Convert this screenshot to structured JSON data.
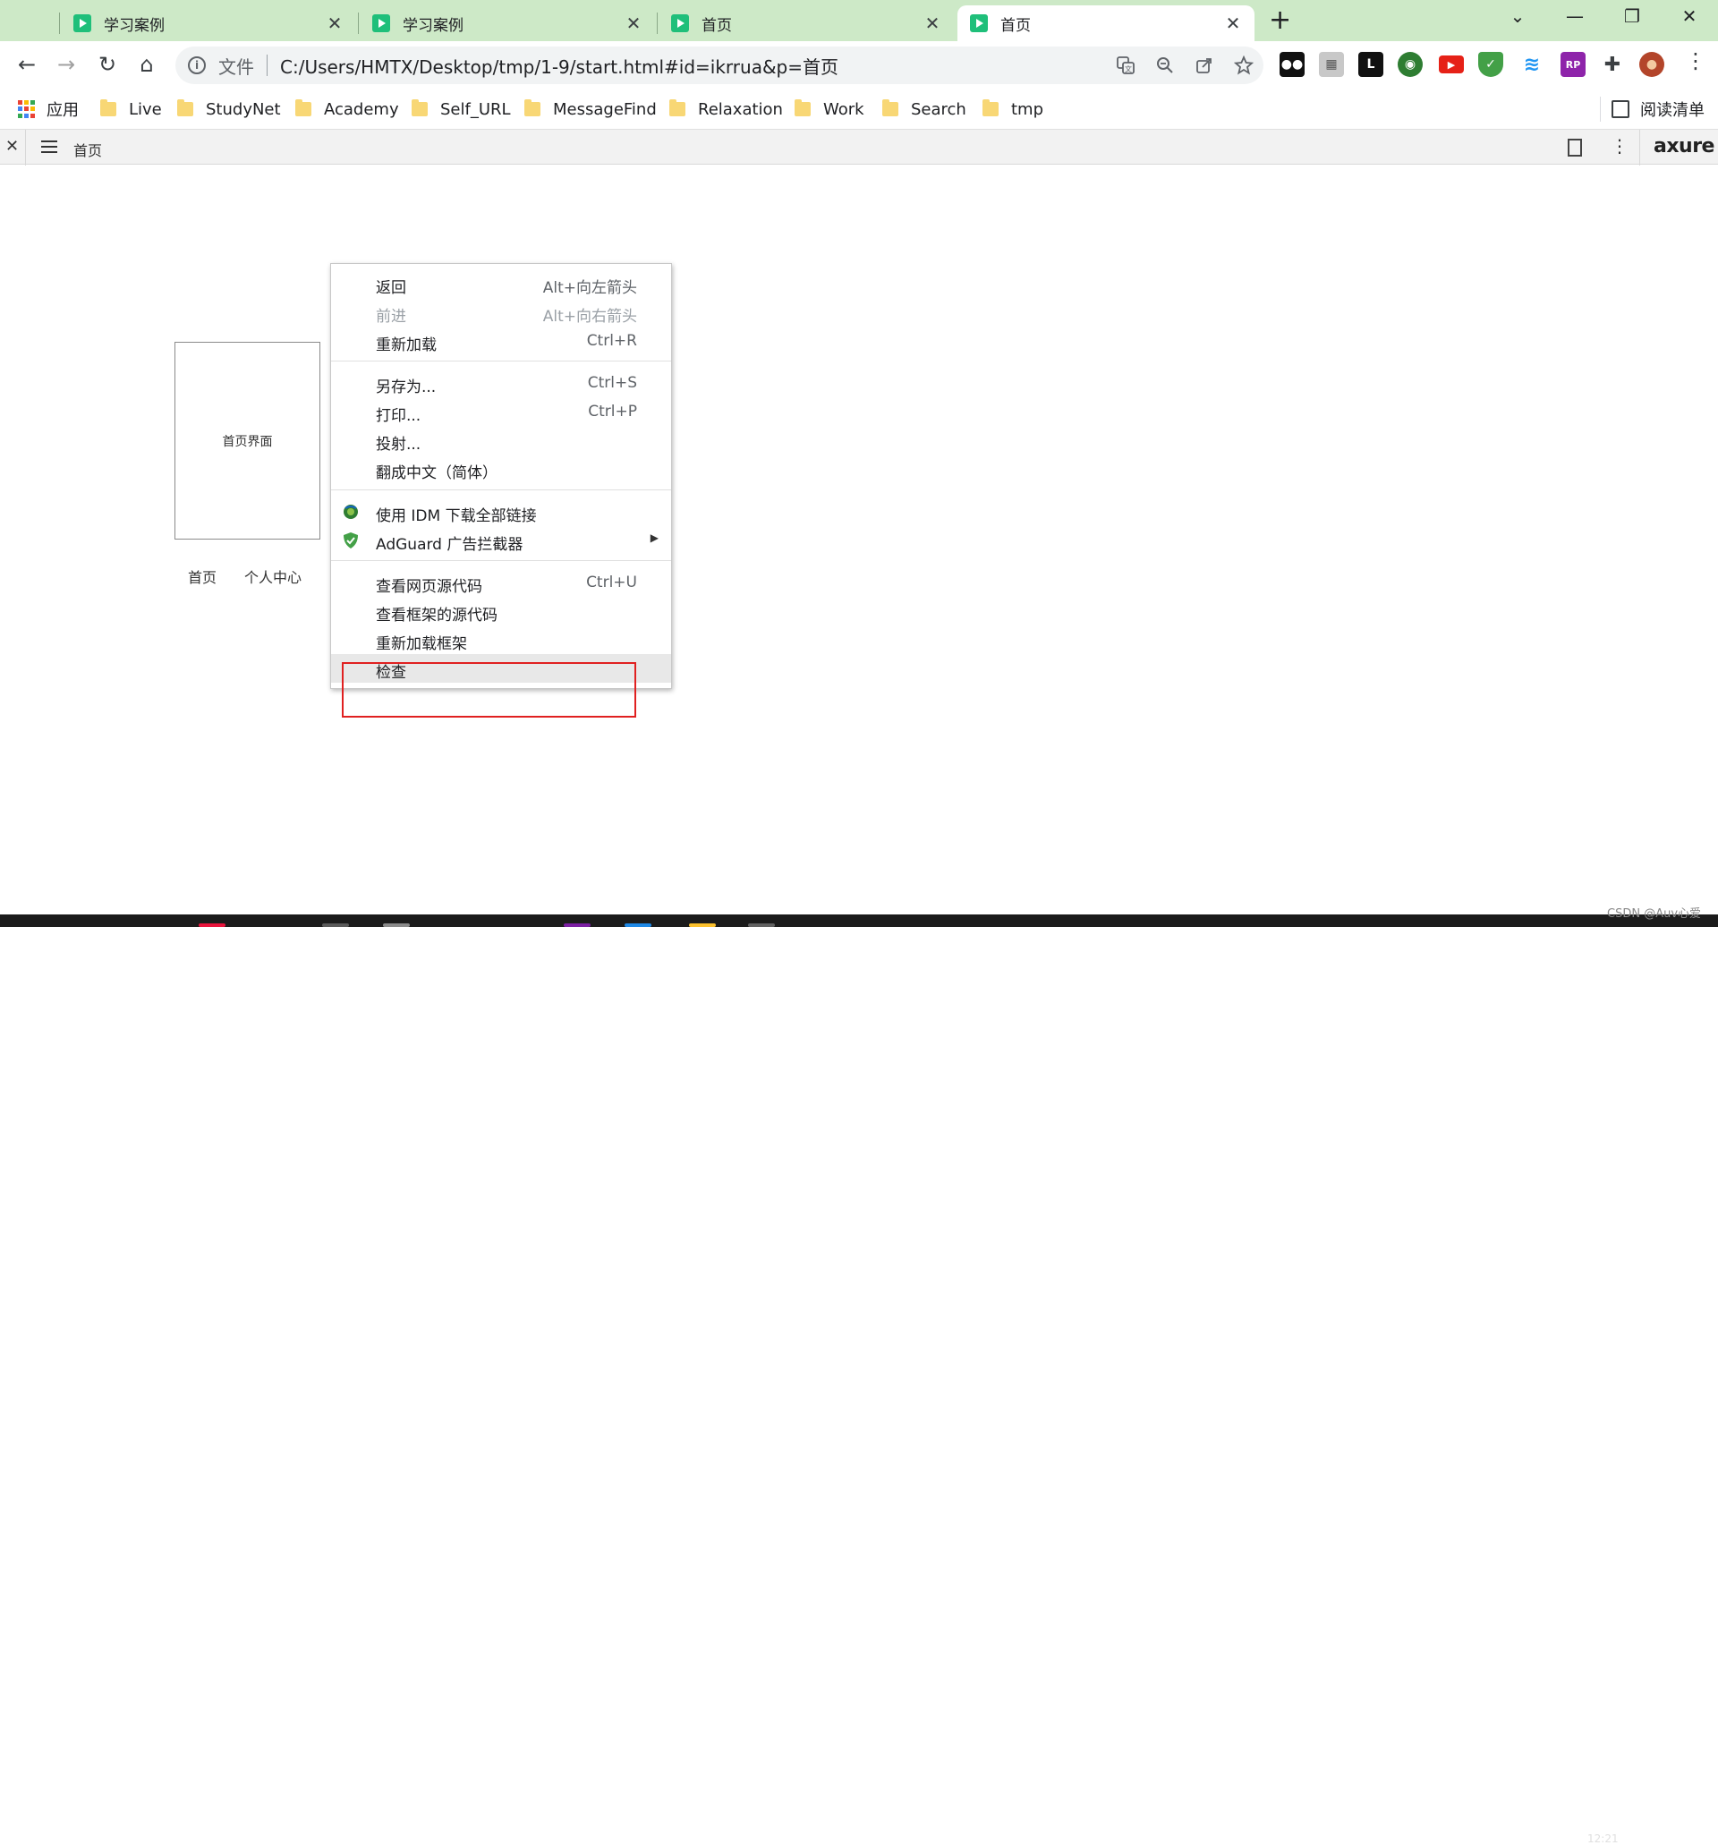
{
  "browser": {
    "tabs": [
      {
        "title": "学习案例",
        "close": "✕",
        "active": false
      },
      {
        "title": "学习案例",
        "close": "✕",
        "active": false
      },
      {
        "title": "首页",
        "close": "✕",
        "active": false
      },
      {
        "title": "首页",
        "close": "✕",
        "active": true
      }
    ],
    "new_tab": "+",
    "window_controls": {
      "tab_search": "⌄",
      "minimize": "—",
      "restore": "❐",
      "close": "✕"
    },
    "nav": {
      "back": "←",
      "forward": "→",
      "reload": "↻",
      "home": "⌂"
    },
    "omnibox": {
      "info": "i",
      "scheme_label": "文件",
      "url": "C:/Users/HMTX/Desktop/tmp/1-9/start.html#id=ikrrua&p=首页",
      "icons": [
        "translate-icon",
        "zoom-icon",
        "share-icon",
        "star-icon"
      ]
    },
    "extensions": [
      {
        "name": "tampermonkey-icon",
        "color": "#111111",
        "glyph": "●●"
      },
      {
        "name": "qr-icon",
        "color": "#c8c8c8",
        "glyph": "▦"
      },
      {
        "name": "listary-icon",
        "color": "#111111",
        "glyph": "L"
      },
      {
        "name": "idm-icon",
        "color": "#2e7d32",
        "glyph": "◉"
      },
      {
        "name": "youtube-icon",
        "color": "#e62117",
        "glyph": "▶"
      },
      {
        "name": "adguard-icon",
        "color": "#43a047",
        "glyph": "✓"
      },
      {
        "name": "wifi-icon",
        "color": "#2196f3",
        "glyph": "≋"
      },
      {
        "name": "axure-rp-icon",
        "color": "#8e24aa",
        "glyph": "RP"
      },
      {
        "name": "extensions-puzzle-icon",
        "color": "#3c4043",
        "glyph": "✚"
      },
      {
        "name": "profile-avatar-icon",
        "color": "#b3452a",
        "glyph": "●"
      }
    ],
    "menu": "⋮"
  },
  "bookmarks": {
    "apps_label": "应用",
    "items": [
      "Live",
      "StudyNet",
      "Academy",
      "Self_URL",
      "MessageFind",
      "Relaxation",
      "Work",
      "Search",
      "tmp"
    ],
    "reading_list": "阅读清单"
  },
  "axure": {
    "close": "✕",
    "page_name": "首页",
    "more": "⋮",
    "logo": "axure"
  },
  "page": {
    "frame_label": "首页界面",
    "links": [
      "首页",
      "个人中心"
    ]
  },
  "context_menu": {
    "groups": [
      [
        {
          "label": "返回",
          "shortcut": "Alt+向左箭头",
          "disabled": false
        },
        {
          "label": "前进",
          "shortcut": "Alt+向右箭头",
          "disabled": true
        },
        {
          "label": "重新加载",
          "shortcut": "Ctrl+R",
          "disabled": false
        }
      ],
      [
        {
          "label": "另存为...",
          "shortcut": "Ctrl+S",
          "disabled": false
        },
        {
          "label": "打印...",
          "shortcut": "Ctrl+P",
          "disabled": false
        },
        {
          "label": "投射...",
          "shortcut": "",
          "disabled": false
        },
        {
          "label": "翻成中文（简体）",
          "shortcut": "",
          "disabled": false
        }
      ],
      [
        {
          "label": "使用 IDM 下载全部链接",
          "shortcut": "",
          "icon": "idm-icon",
          "disabled": false
        },
        {
          "label": "AdGuard 广告拦截器",
          "shortcut": "",
          "icon": "adguard-icon",
          "submenu": "▶",
          "disabled": false
        }
      ],
      [
        {
          "label": "查看网页源代码",
          "shortcut": "Ctrl+U",
          "disabled": false
        },
        {
          "label": "查看框架的源代码",
          "shortcut": "",
          "disabled": false
        },
        {
          "label": "重新加载框架",
          "shortcut": "",
          "disabled": false
        },
        {
          "label": "检查",
          "shortcut": "",
          "disabled": false,
          "hovered": true
        }
      ]
    ]
  },
  "taskbar": {
    "clock": "12:21",
    "watermark": "CSDN @Auv心爱"
  },
  "colors": {
    "tab_strip": "#cde9c7",
    "favicon": "#1fbf7a",
    "highlight_box": "#e02020"
  }
}
